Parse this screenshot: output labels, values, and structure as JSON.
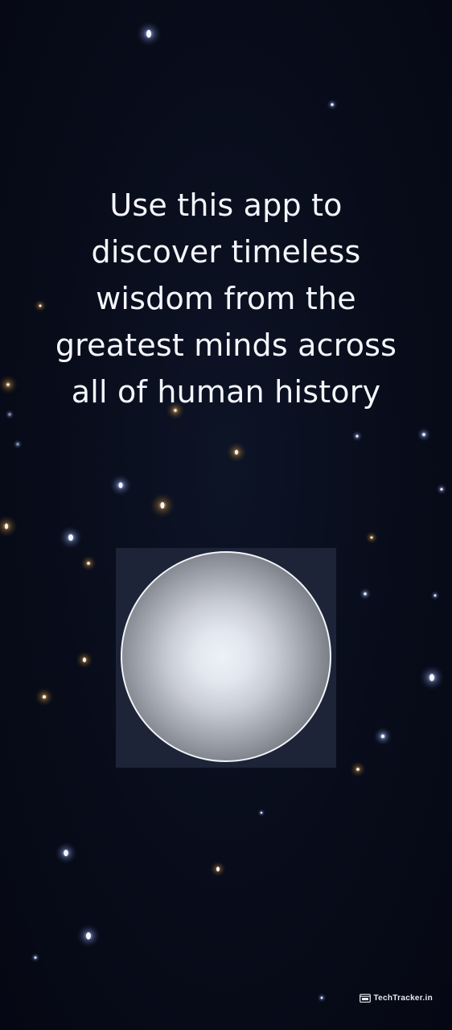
{
  "intro": {
    "lines": [
      "Use this app to",
      "discover timeless",
      "wisdom from the",
      "greatest minds across",
      "all of human history"
    ]
  },
  "orb": {
    "icon": "glowing-orb-icon"
  },
  "watermark": {
    "text": "TechTracker.in",
    "icon": "browser-window-icon"
  },
  "colors": {
    "background": "#070b18",
    "panel": "#1d2438",
    "text": "#f4f6fb",
    "orb_border": "#f2f4f8"
  }
}
